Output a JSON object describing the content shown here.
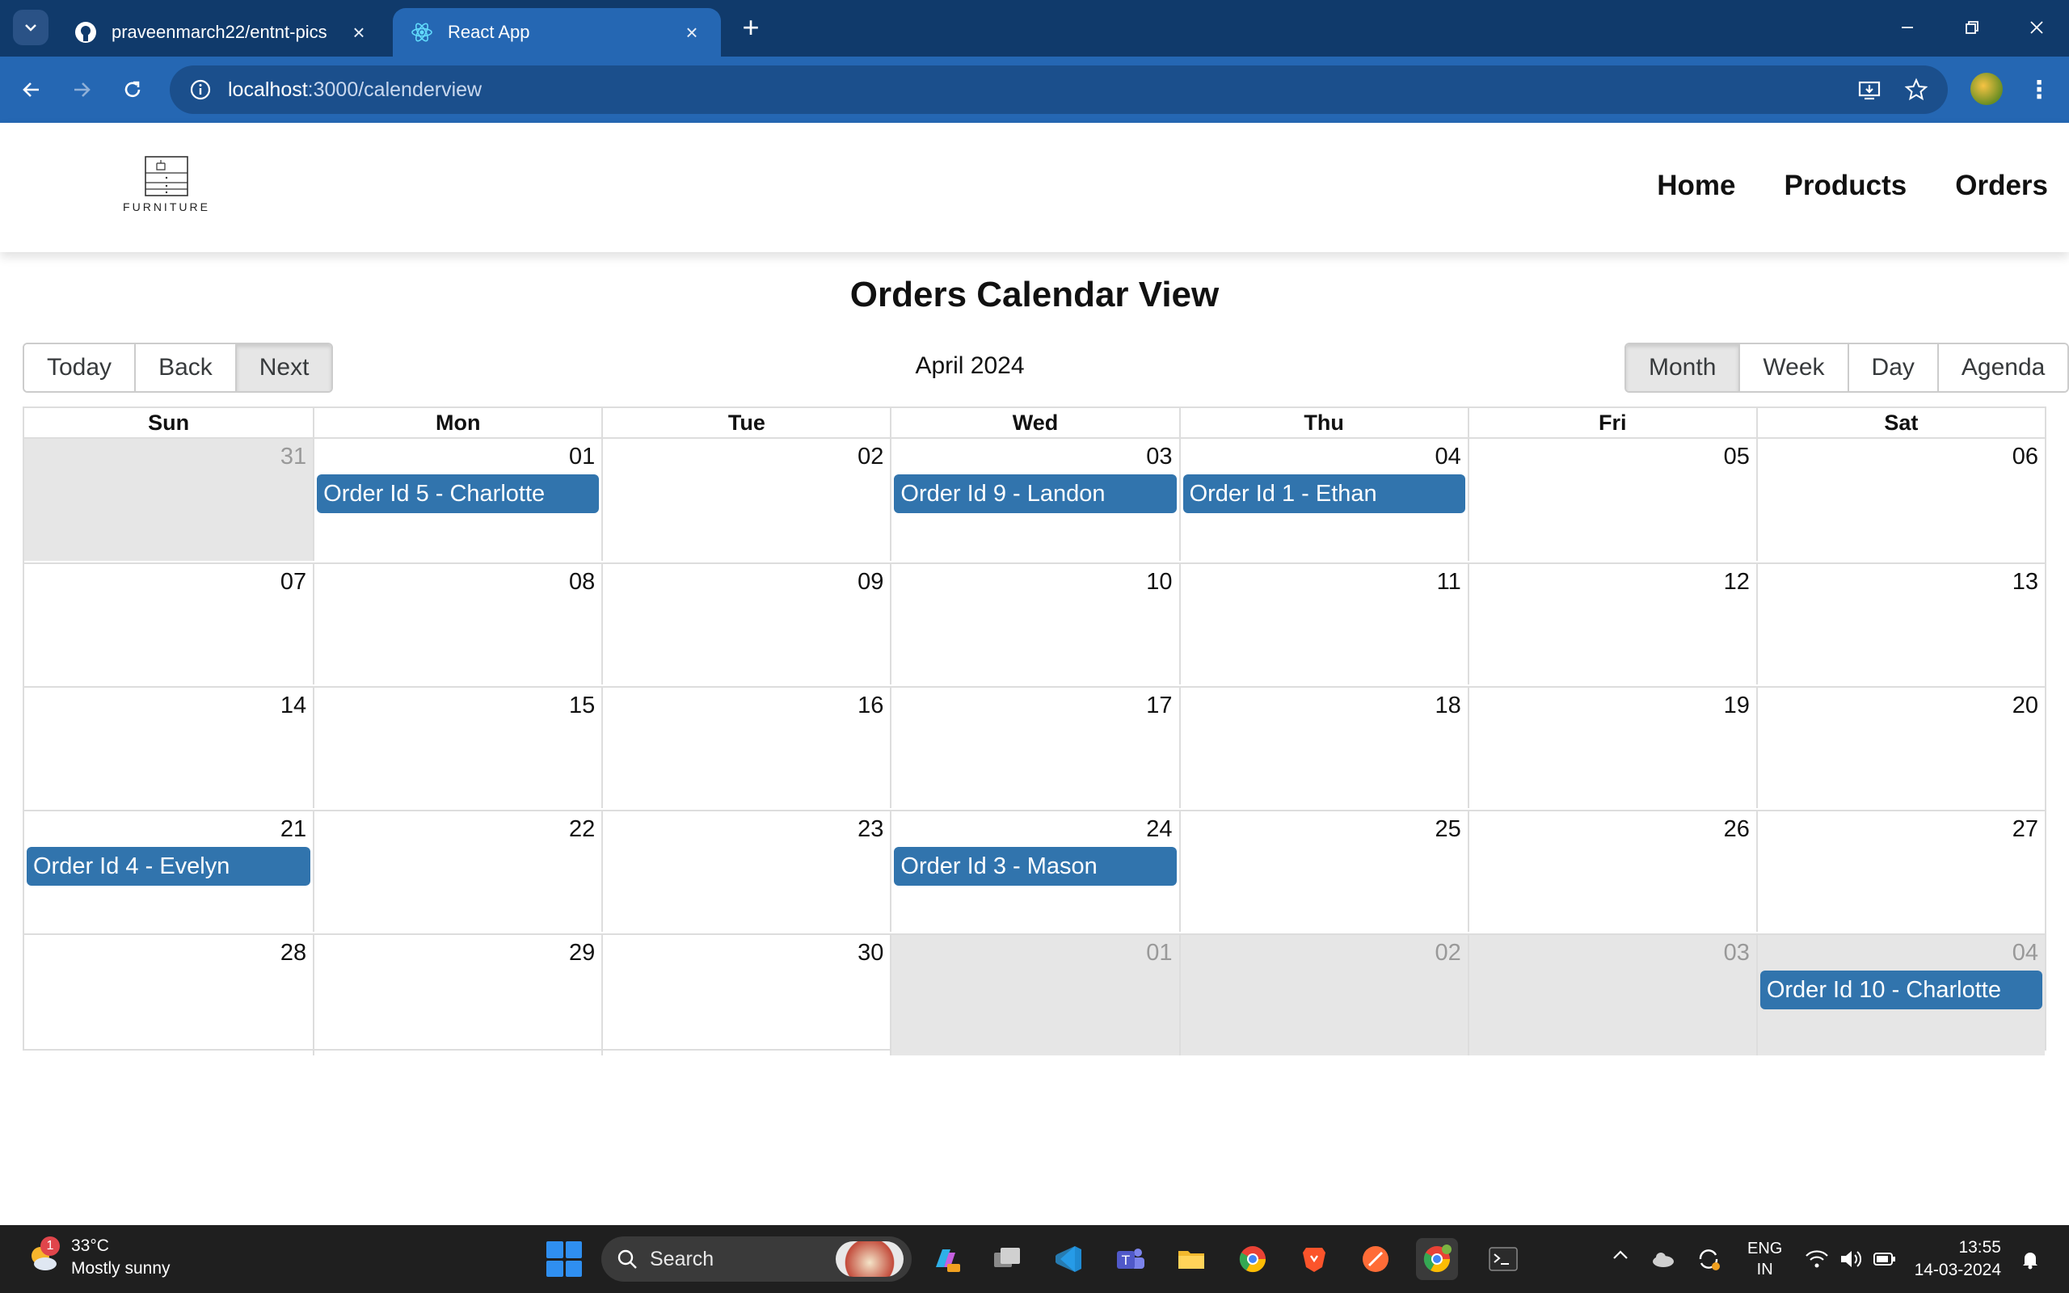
{
  "browser": {
    "tabs": [
      {
        "title": "praveenmarch22/entnt-pics",
        "icon": "github-icon"
      },
      {
        "title": "React App",
        "icon": "react-icon"
      }
    ],
    "url_host": "localhost",
    "url_path": ":3000/calenderview"
  },
  "app": {
    "logo_text": "FURNITURE",
    "nav": {
      "home": "Home",
      "products": "Products",
      "orders": "Orders"
    }
  },
  "calendar": {
    "title": "Orders Calendar View",
    "label": "April 2024",
    "nav_buttons": {
      "today": "Today",
      "back": "Back",
      "next": "Next"
    },
    "views": {
      "month": "Month",
      "week": "Week",
      "day": "Day",
      "agenda": "Agenda"
    },
    "active_view": "Month",
    "weekdays": [
      "Sun",
      "Mon",
      "Tue",
      "Wed",
      "Thu",
      "Fri",
      "Sat"
    ],
    "weeks": [
      [
        {
          "date": "31",
          "off": true
        },
        {
          "date": "01",
          "event": "Order Id 5 - Charlotte"
        },
        {
          "date": "02"
        },
        {
          "date": "03",
          "event": "Order Id 9 - Landon"
        },
        {
          "date": "04",
          "event": "Order Id 1 - Ethan"
        },
        {
          "date": "05"
        },
        {
          "date": "06"
        }
      ],
      [
        {
          "date": "07"
        },
        {
          "date": "08"
        },
        {
          "date": "09"
        },
        {
          "date": "10"
        },
        {
          "date": "11"
        },
        {
          "date": "12"
        },
        {
          "date": "13"
        }
      ],
      [
        {
          "date": "14"
        },
        {
          "date": "15"
        },
        {
          "date": "16"
        },
        {
          "date": "17"
        },
        {
          "date": "18"
        },
        {
          "date": "19"
        },
        {
          "date": "20"
        }
      ],
      [
        {
          "date": "21",
          "event": "Order Id 4 - Evelyn"
        },
        {
          "date": "22"
        },
        {
          "date": "23"
        },
        {
          "date": "24",
          "event": "Order Id 3 - Mason"
        },
        {
          "date": "25"
        },
        {
          "date": "26"
        },
        {
          "date": "27"
        }
      ],
      [
        {
          "date": "28"
        },
        {
          "date": "29"
        },
        {
          "date": "30"
        },
        {
          "date": "01",
          "off": true
        },
        {
          "date": "02",
          "off": true
        },
        {
          "date": "03",
          "off": true
        },
        {
          "date": "04",
          "off": true,
          "event": "Order Id 10 - Charlotte"
        }
      ]
    ]
  },
  "taskbar": {
    "weather_temp": "33°C",
    "weather_desc": "Mostly sunny",
    "weather_badge": "1",
    "search_label": "Search",
    "lang_top": "ENG",
    "lang_bottom": "IN",
    "time": "13:55",
    "date": "14-03-2024"
  },
  "colors": {
    "event_bg": "#3174ad",
    "off_range_bg": "#e6e6e6",
    "browser_frame": "#103a6b",
    "browser_toolbar": "#2567b3"
  }
}
